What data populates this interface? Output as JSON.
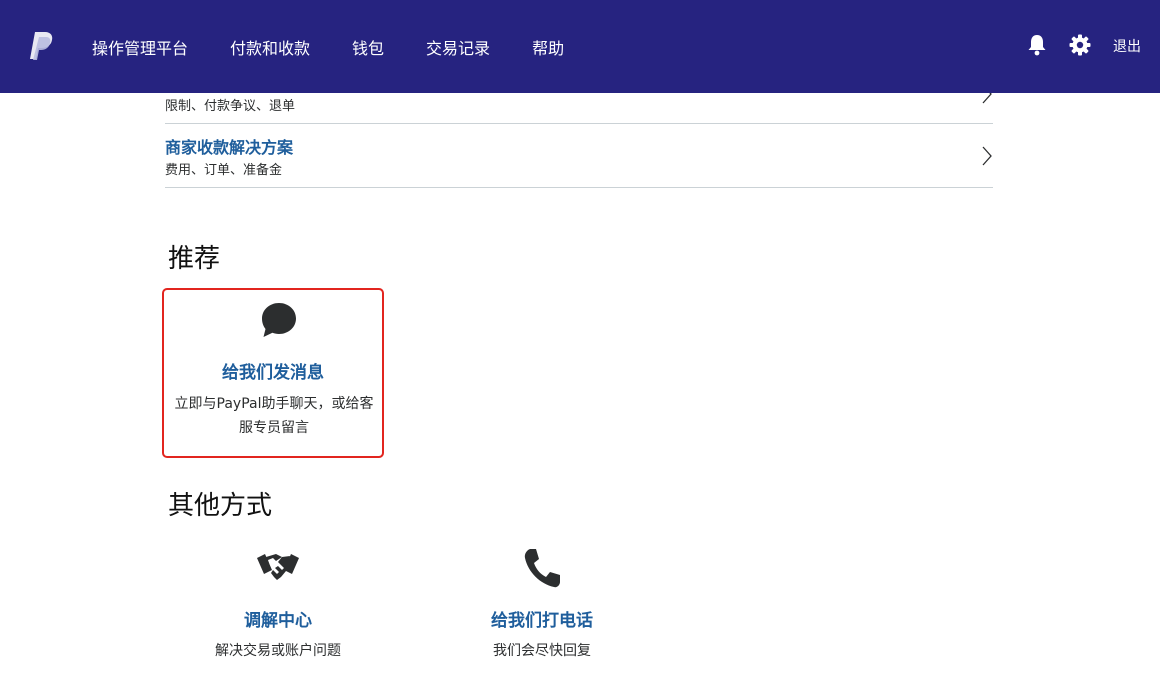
{
  "colors": {
    "header_bg": "#262380",
    "link": "#1f5e9c",
    "highlight_border": "#e2251f",
    "divider": "#cbd2d6"
  },
  "header": {
    "logo_icon": "paypal-logo-icon",
    "nav": [
      {
        "label": "操作管理平台"
      },
      {
        "label": "付款和收款"
      },
      {
        "label": "钱包"
      },
      {
        "label": "交易记录"
      },
      {
        "label": "帮助"
      }
    ],
    "notification_icon": "bell-icon",
    "settings_icon": "gear-icon",
    "logout_label": "退出"
  },
  "help_topics": [
    {
      "subtitle": "限制、付款争议、退单"
    },
    {
      "title": "商家收款解决方案",
      "subtitle": "费用、订单、准备金"
    }
  ],
  "recommended": {
    "heading": "推荐",
    "card": {
      "icon": "chat-bubble-icon",
      "title": "给我们发消息",
      "description": "立即与PayPal助手聊天，或给客服专员留言"
    }
  },
  "other_ways": {
    "heading": "其他方式",
    "options": [
      {
        "icon": "handshake-icon",
        "title": "调解中心",
        "description": "解决交易或账户问题"
      },
      {
        "icon": "phone-icon",
        "title": "给我们打电话",
        "description": "我们会尽快回复"
      }
    ]
  }
}
